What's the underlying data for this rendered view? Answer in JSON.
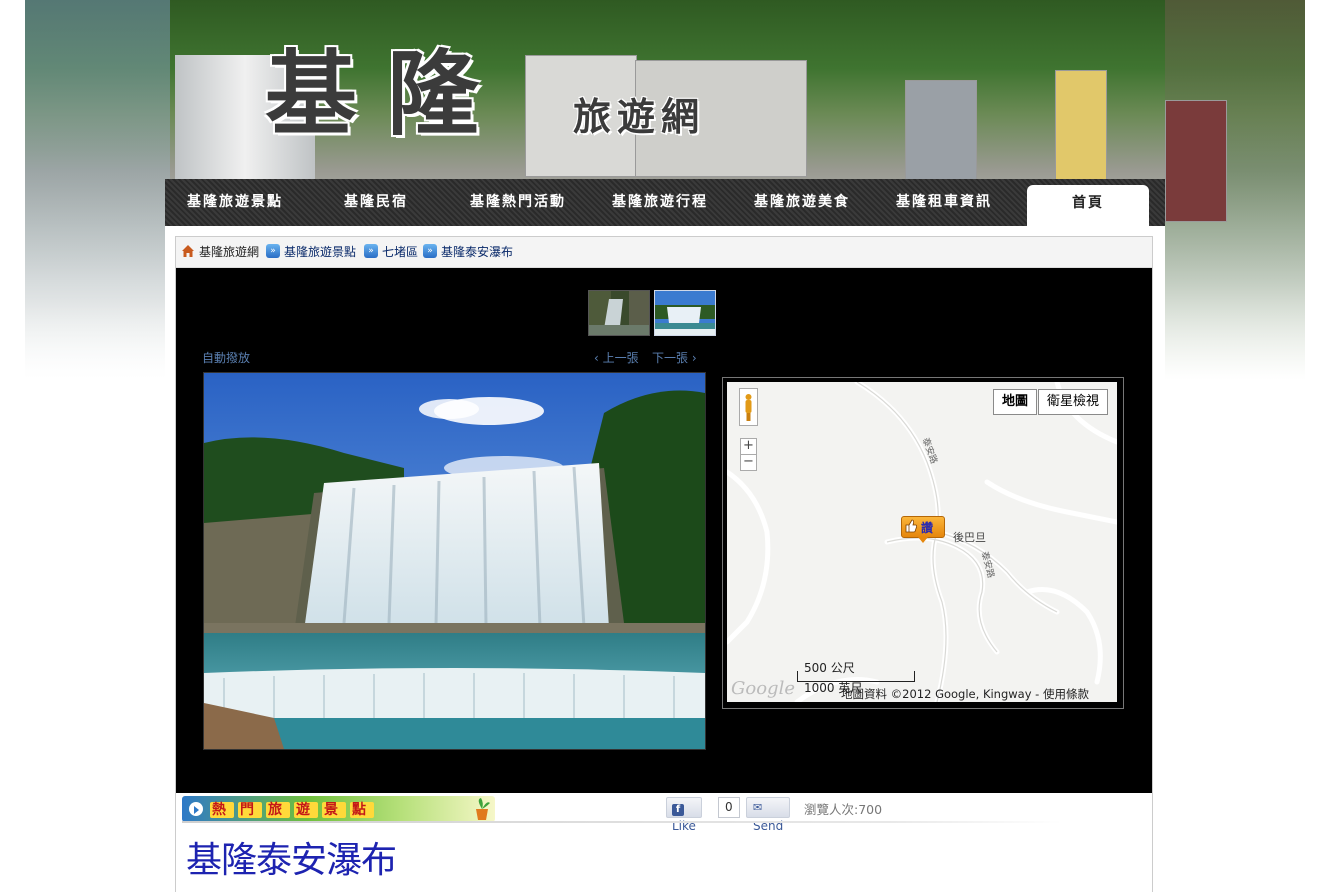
{
  "site": {
    "logo_big": "基隆",
    "logo_small": "旅遊網"
  },
  "nav": {
    "items": [
      {
        "label": "基隆旅遊景點"
      },
      {
        "label": "基隆民宿"
      },
      {
        "label": "基隆熱門活動"
      },
      {
        "label": "基隆旅遊行程"
      },
      {
        "label": "基隆旅遊美食"
      },
      {
        "label": "基隆租車資訊"
      },
      {
        "label": "首頁"
      }
    ],
    "active_index": 6
  },
  "breadcrumb": [
    "基隆旅遊網",
    "基隆旅遊景點",
    "七堵區",
    "基隆泰安瀑布"
  ],
  "gallery": {
    "autoplay_label": "自動撥放",
    "prev_label": "‹ 上一張",
    "next_label": "下一張 ›",
    "thumb_count": 2,
    "selected_thumb": 2
  },
  "map": {
    "map_button": "地圖",
    "satellite_button": "衛星檢視",
    "zoom_in": "+",
    "zoom_out": "−",
    "marker_label": "讚",
    "place_label": "後巴旦",
    "road_label_1": "泰安路",
    "road_label_2": "泰安路",
    "scale_1": "500 公尺",
    "scale_2": "1000 英尺",
    "attribution": "地圖資料 ©2012 Google, Kingway - 使用條款",
    "google_logo": "Google"
  },
  "hot_section": {
    "chars": [
      "熱",
      "門",
      "旅",
      "遊",
      "景",
      "點"
    ]
  },
  "social": {
    "like_label": "Like",
    "like_count": "0",
    "send_label": "Send",
    "views_label": "瀏覽人次:700"
  },
  "page_title": "基隆泰安瀑布",
  "colors": {
    "nav_bg": "#2f2f2f",
    "title_blue": "#1d23b0",
    "link_blue": "#0a2a6a"
  }
}
